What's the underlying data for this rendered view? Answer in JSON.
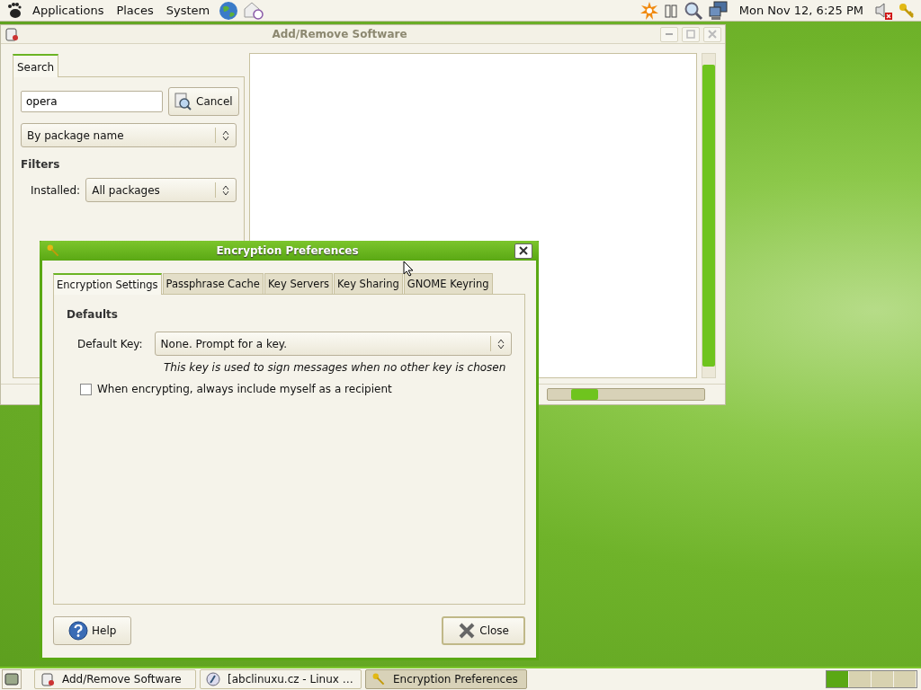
{
  "top_panel": {
    "menus": [
      "Applications",
      "Places",
      "System"
    ],
    "clock": "Mon Nov 12,  6:25 PM"
  },
  "software_window": {
    "title": "Add/Remove Software",
    "tabs": [
      {
        "label": "Search",
        "selected": true
      }
    ],
    "search_field": {
      "value": "opera"
    },
    "cancel_button": "Cancel",
    "search_mode": "By package name",
    "filters_heading": "Filters",
    "installed_label": "Installed:",
    "installed_value": "All packages"
  },
  "dialog": {
    "title": "Encryption Preferences",
    "tabs": [
      {
        "label": "Encryption Settings",
        "selected": true
      },
      {
        "label": "Passphrase Cache",
        "selected": false
      },
      {
        "label": "Key Servers",
        "selected": false
      },
      {
        "label": "Key Sharing",
        "selected": false
      },
      {
        "label": "GNOME Keyring",
        "selected": false
      }
    ],
    "section_heading": "Defaults",
    "default_key_label": "Default Key:",
    "default_key_value": "None. Prompt for a key.",
    "hint": "This key is used to sign messages when no other key is chosen",
    "include_self": {
      "label": "When encrypting, always include myself as a recipient",
      "checked": false
    },
    "help_button": "Help",
    "close_button": "Close"
  },
  "taskbar": {
    "items": [
      {
        "label": "Add/Remove Software",
        "selected": false,
        "kind": "software"
      },
      {
        "label": "[abclinuxu.cz - Linux …",
        "selected": false,
        "kind": "browser"
      },
      {
        "label": "Encryption Preferences",
        "selected": true,
        "kind": "keys"
      }
    ],
    "workspaces": [
      {
        "selected": true
      },
      {
        "selected": false
      },
      {
        "selected": false
      },
      {
        "selected": false
      }
    ]
  }
}
